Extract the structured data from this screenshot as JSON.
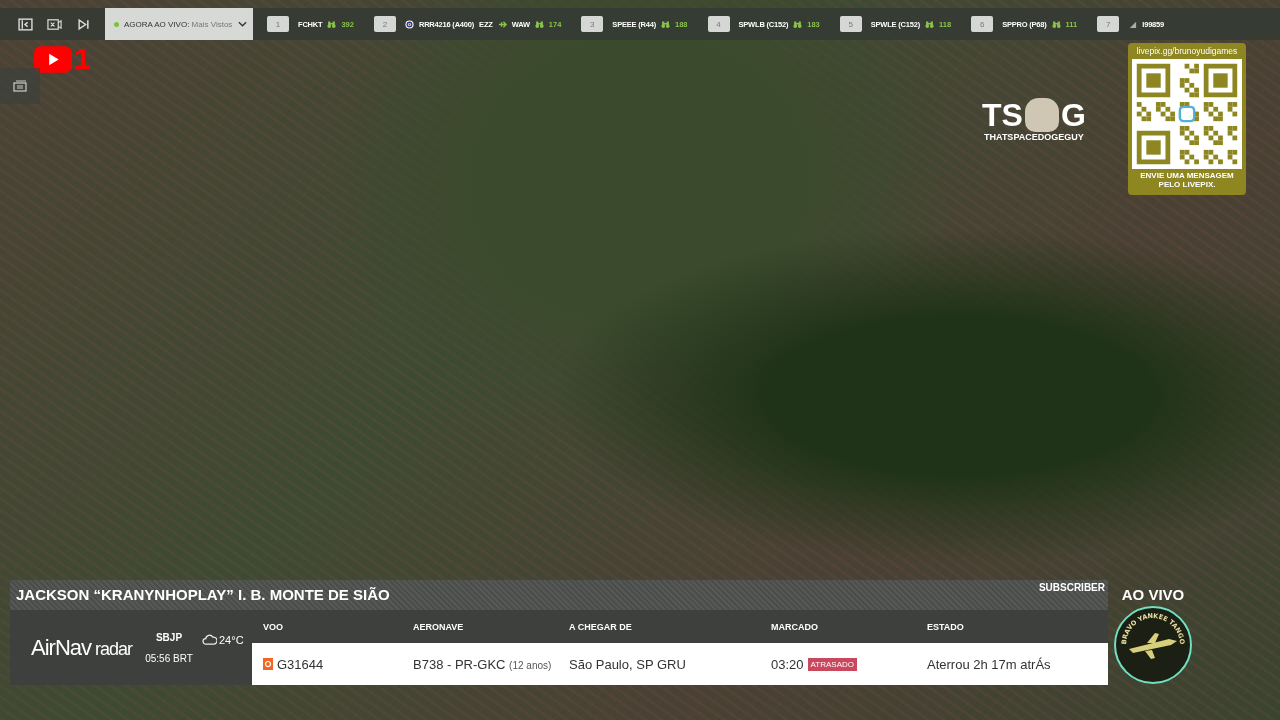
{
  "top_bar": {
    "feed_selector": {
      "label": "AGORA AO VIVO:",
      "value": "Mais Vistos",
      "live": true
    },
    "flights": [
      {
        "rank": "1",
        "kind": "civil",
        "callsign": "FCHKT",
        "viewers": "392"
      },
      {
        "rank": "2",
        "kind": "military",
        "callsign": "RRR4216 (A400)",
        "route_from": "EZZ",
        "route_to": "WAW",
        "viewers": "174"
      },
      {
        "rank": "3",
        "kind": "civil",
        "callsign": "SPEEE (R44)",
        "viewers": "188"
      },
      {
        "rank": "4",
        "kind": "civil",
        "callsign": "SPWLB (C152)",
        "viewers": "183"
      },
      {
        "rank": "5",
        "kind": "civil",
        "callsign": "SPWLE (C152)",
        "viewers": "118"
      },
      {
        "rank": "6",
        "kind": "civil",
        "callsign": "SPPRO (P68)",
        "viewers": "111"
      },
      {
        "rank": "7",
        "kind": "unknown",
        "callsign": "I99859"
      }
    ]
  },
  "youtube_badge": {
    "count": "1"
  },
  "channel_logo": {
    "left": "TS",
    "right": "G",
    "caption": "THATSPACEDOGEGUY"
  },
  "livepix": {
    "url": "livepix.gg/brunoyudigames",
    "message": "ENVIE UMA MENSAGEM PELO LIVEPIX."
  },
  "flight_panel": {
    "pilot": "JACKSON “KRANYNHOPLAY” I. B. MONTE DE SIÃO",
    "tag": "SUBSCRIBER",
    "brand": {
      "main": "AirNav",
      "sub": "radar"
    },
    "airport": {
      "code": "SBJP",
      "time": "05:56 BRT"
    },
    "weather": {
      "temperature": "24°C"
    },
    "columns": [
      "VOO",
      "AERONAVE",
      "A CHEGAR DE",
      "MARCADO",
      "ESTADO"
    ],
    "row": {
      "flight": "G31644",
      "aircraft": "B738 - PR-GKC",
      "age": "(12 anos)",
      "origin": "São Paulo, SP GRU",
      "scheduled": "03:20",
      "delayed": true,
      "delay_label": "ATRASADO",
      "status": "Aterrou 2h 17m atrÁs"
    }
  },
  "live_label": "AO VIVO",
  "emblem": {
    "text": "BRAVO YANKEE TANGO"
  }
}
